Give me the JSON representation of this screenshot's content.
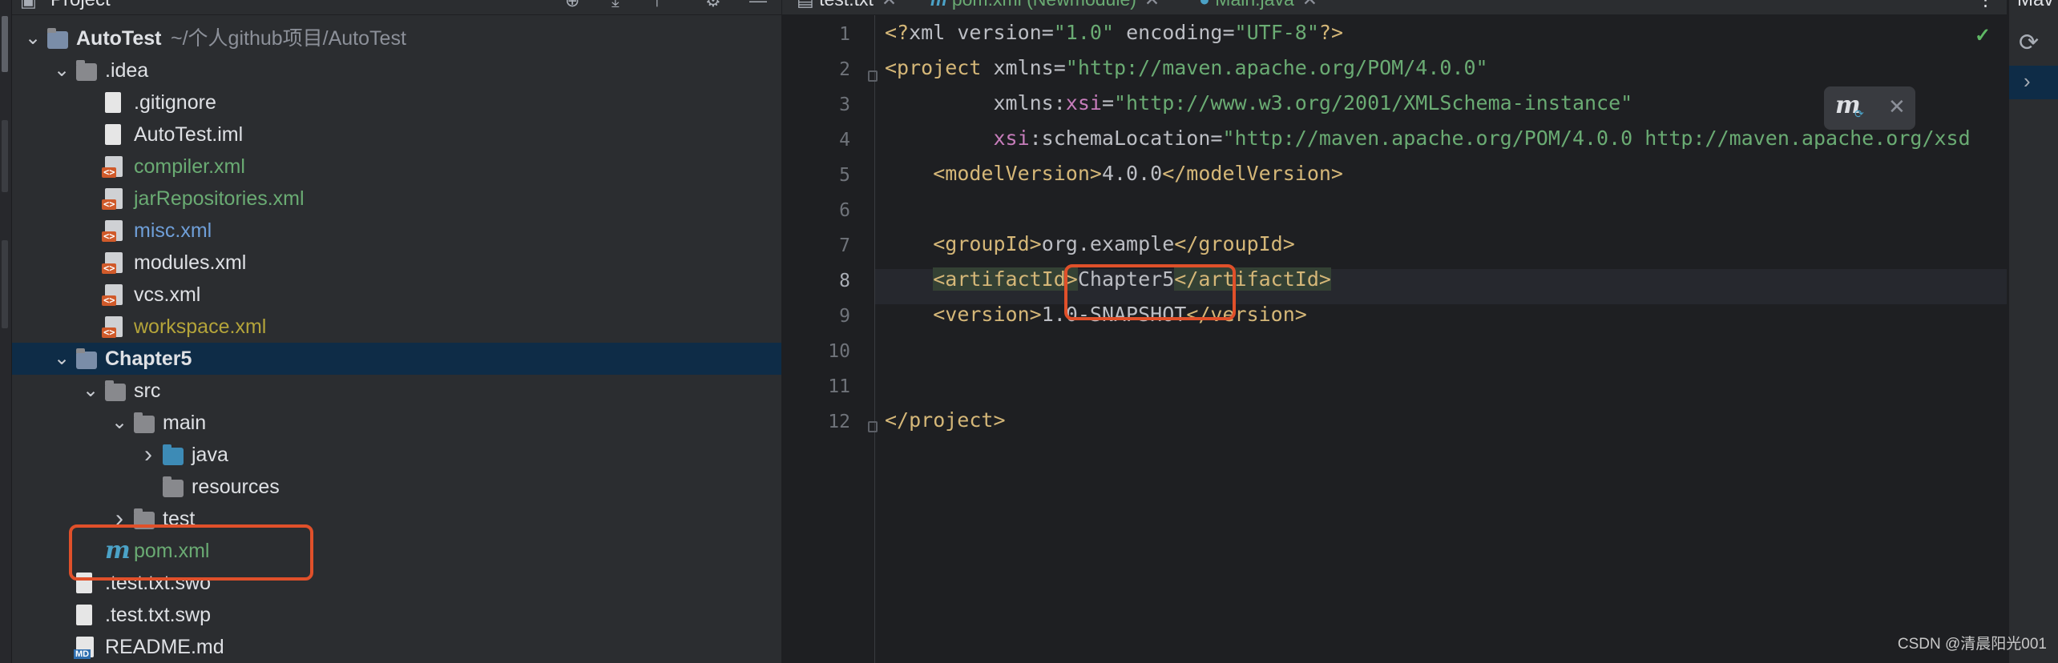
{
  "project_panel": {
    "title": "Project",
    "tree": [
      {
        "label": "AutoTest",
        "path": "~/个人github项目/AutoTest",
        "type": "module",
        "indent": 0,
        "expanded": true
      },
      {
        "label": ".idea",
        "type": "folder",
        "indent": 1,
        "expanded": true
      },
      {
        "label": ".gitignore",
        "type": "file",
        "indent": 2
      },
      {
        "label": "AutoTest.iml",
        "type": "file",
        "indent": 2
      },
      {
        "label": "compiler.xml",
        "type": "xml",
        "indent": 2,
        "color": "green"
      },
      {
        "label": "jarRepositories.xml",
        "type": "xml",
        "indent": 2,
        "color": "green"
      },
      {
        "label": "misc.xml",
        "type": "xml",
        "indent": 2,
        "color": "blue"
      },
      {
        "label": "modules.xml",
        "type": "xml",
        "indent": 2
      },
      {
        "label": "vcs.xml",
        "type": "xml",
        "indent": 2
      },
      {
        "label": "workspace.xml",
        "type": "xml",
        "indent": 2,
        "color": "yellow"
      },
      {
        "label": "Chapter5",
        "type": "module",
        "indent": 1,
        "expanded": true,
        "selected": true
      },
      {
        "label": "src",
        "type": "folder",
        "indent": 2,
        "expanded": true
      },
      {
        "label": "main",
        "type": "folder",
        "indent": 3,
        "expanded": true
      },
      {
        "label": "java",
        "type": "folder-blue",
        "indent": 4,
        "expanded": false
      },
      {
        "label": "resources",
        "type": "folder",
        "indent": 4
      },
      {
        "label": "test",
        "type": "folder",
        "indent": 3,
        "expanded": false
      },
      {
        "label": "pom.xml",
        "type": "maven",
        "indent": 2,
        "color": "green"
      },
      {
        "label": ".test.txt.swo",
        "type": "doc",
        "indent": 1
      },
      {
        "label": ".test.txt.swp",
        "type": "doc",
        "indent": 1
      },
      {
        "label": "README.md",
        "type": "md",
        "indent": 1
      }
    ]
  },
  "editor": {
    "tabs": [
      {
        "label": "test.txt",
        "active": false
      },
      {
        "label": "pom.xml (Newmodule)",
        "active": true
      },
      {
        "label": "Main.java",
        "active": false
      }
    ],
    "current_line": 8,
    "lines": [
      {
        "n": "1",
        "parts": [
          [
            "pi",
            "<?"
          ],
          [
            "at",
            "xml version"
          ],
          [
            "at",
            "="
          ],
          [
            "str",
            "\"1.0\""
          ],
          [
            "at",
            " encoding"
          ],
          [
            "at",
            "="
          ],
          [
            "str",
            "\"UTF-8\""
          ],
          [
            "pi",
            "?>"
          ]
        ]
      },
      {
        "n": "2",
        "parts": [
          [
            "tg",
            "<project"
          ],
          [
            "at",
            " xmlns"
          ],
          [
            "at",
            "="
          ],
          [
            "str",
            "\"http://maven.apache.org/POM/4.0.0\""
          ]
        ]
      },
      {
        "n": "3",
        "parts": [
          [
            "at",
            "         xmlns:"
          ],
          [
            "ns",
            "xsi"
          ],
          [
            "at",
            "="
          ],
          [
            "str",
            "\"http://www.w3.org/2001/XMLSchema-instance\""
          ]
        ]
      },
      {
        "n": "4",
        "parts": [
          [
            "at",
            "         "
          ],
          [
            "ns",
            "xsi"
          ],
          [
            "at",
            ":schemaLocation"
          ],
          [
            "at",
            "="
          ],
          [
            "str",
            "\"http://maven.apache.org/POM/4.0.0 http://maven.apache.org/xsd"
          ]
        ]
      },
      {
        "n": "5",
        "parts": [
          [
            "at",
            "    "
          ],
          [
            "tg",
            "<modelVersion>"
          ],
          [
            "at",
            "4.0.0"
          ],
          [
            "tg",
            "</modelVersion>"
          ]
        ]
      },
      {
        "n": "6",
        "parts": []
      },
      {
        "n": "7",
        "parts": [
          [
            "at",
            "    "
          ],
          [
            "tg",
            "<groupId>"
          ],
          [
            "at",
            "org.example"
          ],
          [
            "tg",
            "</groupId>"
          ]
        ]
      },
      {
        "n": "8",
        "parts": [
          [
            "at",
            "    "
          ],
          [
            "tg hl",
            "<artifactId>"
          ],
          [
            "at",
            "Chapter5"
          ],
          [
            "tg hl",
            "</artifactId>"
          ]
        ]
      },
      {
        "n": "9",
        "parts": [
          [
            "at",
            "    "
          ],
          [
            "tg",
            "<version>"
          ],
          [
            "at",
            "1.0-SNAPSHOT"
          ],
          [
            "tg",
            "</version>"
          ]
        ]
      },
      {
        "n": "10",
        "parts": []
      },
      {
        "n": "11",
        "parts": []
      },
      {
        "n": "12",
        "parts": [
          [
            "tg",
            "</project>"
          ]
        ]
      }
    ]
  },
  "right_panel": {
    "title": "Mav"
  },
  "watermark": "CSDN @清晨阳光001",
  "colors": {
    "selection": "#0e2c47",
    "highlight_box": "#e0502a",
    "green_file": "#6aab73"
  }
}
